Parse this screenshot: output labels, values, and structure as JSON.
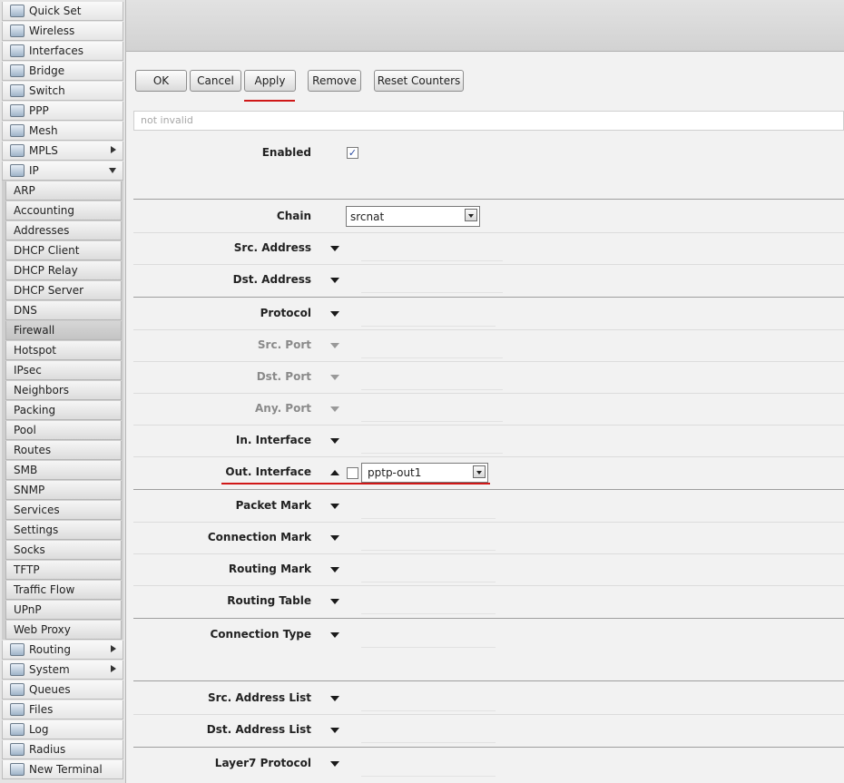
{
  "sidebar": {
    "items": [
      {
        "label": "Quick Set",
        "icon": "quick-set-icon",
        "arrow": ""
      },
      {
        "label": "Wireless",
        "icon": "antenna-icon",
        "arrow": ""
      },
      {
        "label": "Interfaces",
        "icon": "interfaces-icon",
        "arrow": ""
      },
      {
        "label": "Bridge",
        "icon": "bridge-icon",
        "arrow": ""
      },
      {
        "label": "Switch",
        "icon": "switch-icon",
        "arrow": ""
      },
      {
        "label": "PPP",
        "icon": "ppp-icon",
        "arrow": ""
      },
      {
        "label": "Mesh",
        "icon": "mesh-icon",
        "arrow": ""
      },
      {
        "label": "MPLS",
        "icon": "mpls-icon",
        "arrow": "right"
      },
      {
        "label": "IP",
        "icon": "ip-icon",
        "arrow": "down"
      }
    ],
    "ip_submenu": [
      "ARP",
      "Accounting",
      "Addresses",
      "DHCP Client",
      "DHCP Relay",
      "DHCP Server",
      "DNS",
      "Firewall",
      "Hotspot",
      "IPsec",
      "Neighbors",
      "Packing",
      "Pool",
      "Routes",
      "SMB",
      "SNMP",
      "Services",
      "Settings",
      "Socks",
      "TFTP",
      "Traffic Flow",
      "UPnP",
      "Web Proxy"
    ],
    "ip_submenu_active": "Firewall",
    "bottom_items": [
      {
        "label": "Routing",
        "icon": "routing-icon",
        "arrow": "right"
      },
      {
        "label": "System",
        "icon": "gear-icon",
        "arrow": "right"
      },
      {
        "label": "Queues",
        "icon": "queues-icon",
        "arrow": ""
      },
      {
        "label": "Files",
        "icon": "folder-icon",
        "arrow": ""
      },
      {
        "label": "Log",
        "icon": "log-icon",
        "arrow": ""
      },
      {
        "label": "Radius",
        "icon": "users-icon",
        "arrow": ""
      },
      {
        "label": "New Terminal",
        "icon": "terminal-icon",
        "arrow": ""
      }
    ]
  },
  "toolbar": {
    "ok_label": "OK",
    "cancel_label": "Cancel",
    "apply_label": "Apply",
    "remove_label": "Remove",
    "reset_counters_label": "Reset Counters"
  },
  "status_text": "not invalid",
  "form": {
    "enabled_label": "Enabled",
    "enabled_checked": true,
    "chain_label": "Chain",
    "chain_value": "srcnat",
    "src_address_label": "Src. Address",
    "dst_address_label": "Dst. Address",
    "protocol_label": "Protocol",
    "src_port_label": "Src. Port",
    "dst_port_label": "Dst. Port",
    "any_port_label": "Any. Port",
    "in_interface_label": "In. Interface",
    "out_interface_label": "Out. Interface",
    "out_interface_value": "pptp-out1",
    "out_interface_negate": false,
    "packet_mark_label": "Packet Mark",
    "connection_mark_label": "Connection Mark",
    "routing_mark_label": "Routing Mark",
    "routing_table_label": "Routing Table",
    "connection_type_label": "Connection Type",
    "src_address_list_label": "Src. Address List",
    "dst_address_list_label": "Dst. Address List",
    "layer7_protocol_label": "Layer7 Protocol"
  },
  "colors": {
    "highlight_underline": "#d01818",
    "checkmark": "#2a4aa0"
  }
}
